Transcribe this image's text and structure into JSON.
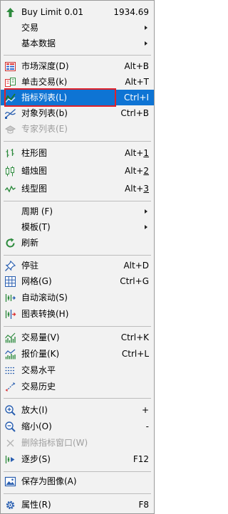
{
  "menu": {
    "buy_limit": {
      "label": "Buy Limit 0.01",
      "value": "1934.69"
    },
    "trading": {
      "label": "交易"
    },
    "fundamentals": {
      "label": "基本数据"
    },
    "depth": {
      "label": "市场深度(D)",
      "shortcut": "Alt+B"
    },
    "one_click": {
      "label": "单击交易(k)",
      "shortcut": "Alt+T"
    },
    "indicators": {
      "label": "指标列表(L)",
      "shortcut": "Ctrl+I"
    },
    "objects": {
      "label": "对象列表(b)",
      "shortcut": "Ctrl+B"
    },
    "experts": {
      "label": "专家列表(E)"
    },
    "bar_chart": {
      "label": "柱形图",
      "shortcut_prefix": "Alt+",
      "shortcut_key": "1"
    },
    "candles": {
      "label": "蜡烛图",
      "shortcut_prefix": "Alt+",
      "shortcut_key": "2"
    },
    "line_chart": {
      "label": "线型图",
      "shortcut_prefix": "Alt+",
      "shortcut_key": "3"
    },
    "period": {
      "label": "周期 (F)"
    },
    "template": {
      "label": "模板(T)"
    },
    "refresh": {
      "label": "刷新"
    },
    "dock": {
      "label": "停驻",
      "shortcut": "Alt+D"
    },
    "grid": {
      "label": "网格(G)",
      "shortcut": "Ctrl+G"
    },
    "autoscroll": {
      "label": "自动滚动(S)"
    },
    "chart_shift": {
      "label": "图表转换(H)"
    },
    "volumes": {
      "label": "交易量(V)",
      "shortcut": "Ctrl+K"
    },
    "tick_volumes": {
      "label": "报价量(K)",
      "shortcut": "Ctrl+L"
    },
    "trade_levels": {
      "label": "交易水平"
    },
    "trade_history": {
      "label": "交易历史"
    },
    "zoom_in": {
      "label": "放大(I)",
      "shortcut": "+"
    },
    "zoom_out": {
      "label": "缩小(O)",
      "shortcut": "-"
    },
    "delete_window": {
      "label": "删除指标窗口(W)"
    },
    "step": {
      "label": "逐步(S)",
      "shortcut": "F12"
    },
    "save_picture": {
      "label": "保存为图像(A)"
    },
    "properties": {
      "label": "属性(R)",
      "shortcut": "F8"
    }
  },
  "colors": {
    "selection": "#0e74d4",
    "highlight_border": "#e0212a",
    "disabled_text": "#9e9e9e"
  },
  "icons": [
    "buy-limit-icon",
    "depth-of-market-icon",
    "one-click-trading-icon",
    "indicator-list-icon",
    "object-list-icon",
    "expert-list-icon",
    "bar-chart-icon",
    "candlestick-icon",
    "line-chart-icon",
    "refresh-icon",
    "pin-icon",
    "grid-icon",
    "autoscroll-icon",
    "chart-shift-icon",
    "volumes-icon",
    "tick-volumes-icon",
    "trade-levels-icon",
    "trade-history-icon",
    "zoom-in-icon",
    "zoom-out-icon",
    "close-icon",
    "step-icon",
    "save-picture-icon",
    "properties-icon"
  ]
}
